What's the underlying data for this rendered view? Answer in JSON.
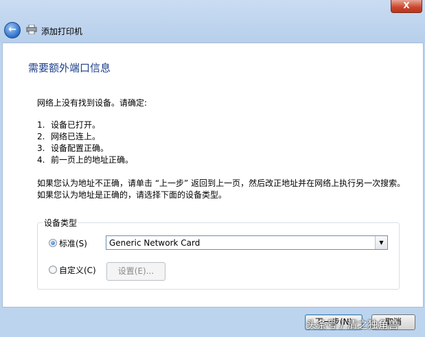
{
  "window": {
    "title": "添加打印机",
    "close_label": "X"
  },
  "icons": {
    "back": "back-arrow-icon",
    "printer": "printer-icon",
    "close": "close-icon"
  },
  "page": {
    "heading": "需要额外端口信息",
    "intro": "网络上没有找到设备。请确定:",
    "steps": [
      {
        "num": "1.",
        "text": "设备已打开。"
      },
      {
        "num": "2.",
        "text": "网络已连上。"
      },
      {
        "num": "3.",
        "text": "设备配置正确。"
      },
      {
        "num": "4.",
        "text": "前一页上的地址正确。"
      }
    ],
    "explain": "如果您认为地址不正确，请单击 “上一步” 返回到上一页，然后改正地址并在网络上执行另一次搜索。如果您认为地址是正确的，请选择下面的设备类型。"
  },
  "device_type": {
    "legend": "设备类型",
    "standard_label": "标准(S)",
    "standard_selected": true,
    "standard_value": "Generic Network Card",
    "custom_label": "自定义(C)",
    "custom_selected": false,
    "settings_label": "设置(E)..."
  },
  "footer": {
    "next_label": "下一步(N)",
    "cancel_label": "取消"
  },
  "watermark": "头条号 / 清之独角兽"
}
